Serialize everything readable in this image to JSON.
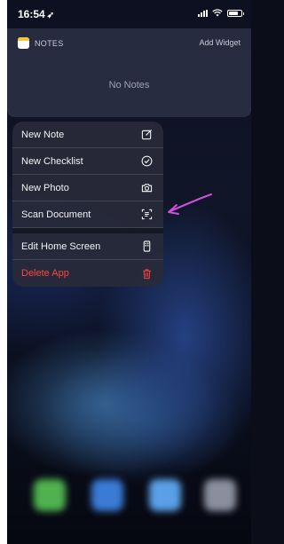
{
  "status": {
    "time": "16:54",
    "location_arrow": "➶"
  },
  "widget": {
    "title": "NOTES",
    "add_widget": "Add Widget",
    "empty_text": "No Notes"
  },
  "menu": {
    "items": [
      {
        "label": "New Note",
        "icon": "compose-icon"
      },
      {
        "label": "New Checklist",
        "icon": "checkmark-circle-icon"
      },
      {
        "label": "New Photo",
        "icon": "camera-icon"
      },
      {
        "label": "Scan Document",
        "icon": "scan-document-icon"
      }
    ],
    "system_items": [
      {
        "label": "Edit Home Screen",
        "icon": "phone-edit-icon"
      },
      {
        "label": "Delete App",
        "icon": "trash-icon",
        "color": "#ff453a"
      }
    ]
  },
  "colors": {
    "accent_arrow": "#d14fd6",
    "danger": "#ff453a",
    "notes_yellow": "#f5c542"
  },
  "dock": {
    "apps": [
      "messages-app",
      "mail-app",
      "safari-app",
      "settings-app"
    ]
  }
}
